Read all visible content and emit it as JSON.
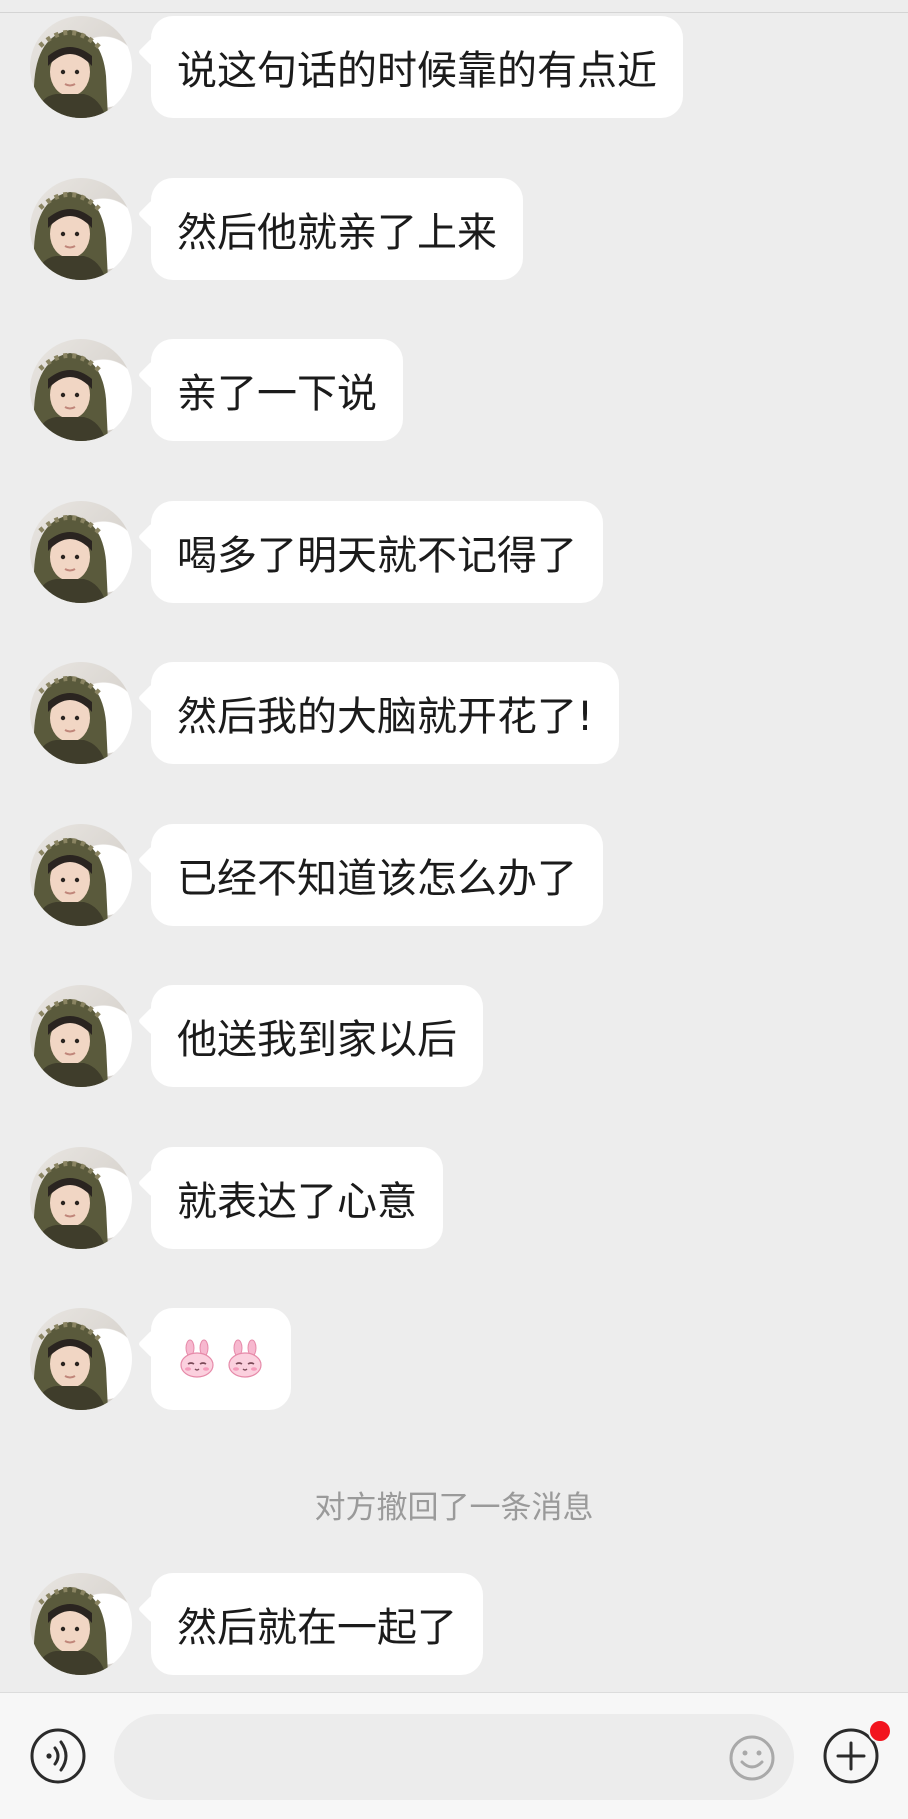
{
  "messages": [
    {
      "text": "说这句话的时候靠的有点近"
    },
    {
      "text": "然后他就亲了上来"
    },
    {
      "text": "亲了一下说"
    },
    {
      "text": "喝多了明天就不记得了"
    },
    {
      "text": "然后我的大脑就开花了!"
    },
    {
      "text": "已经不知道该怎么办了"
    },
    {
      "text": "他送我到家以后"
    },
    {
      "text": "就表达了心意"
    },
    {
      "stickers": [
        "bunny-emoji",
        "bunny-emoji"
      ]
    },
    {
      "text": "然后就在一起了"
    }
  ],
  "system_notice": "对方撤回了一条消息",
  "input_bar": {
    "placeholder": "",
    "value": "",
    "has_notification": true
  },
  "colors": {
    "background": "#ededed",
    "bubble": "#ffffff",
    "notification": "#f2141e"
  }
}
